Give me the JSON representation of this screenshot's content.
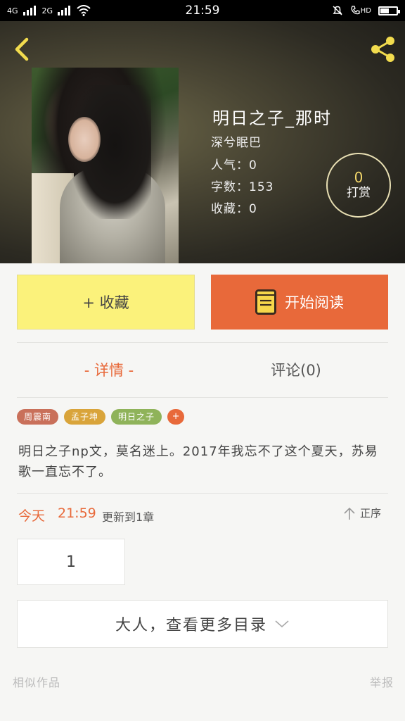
{
  "status_bar": {
    "network_1": "4G",
    "network_2": "2G",
    "time": "21:59",
    "hd": "HD"
  },
  "book": {
    "title": "明日之子_那时",
    "author": "深兮眠巴",
    "popularity": "人气：0",
    "word_count": "字数：153",
    "favorites": "收藏：0",
    "tip_count": "0",
    "tip_label": "打赏"
  },
  "actions": {
    "collect_label": "+ 收藏",
    "read_label": "开始阅读"
  },
  "tabs": {
    "detail": "-  详情  -",
    "comments": "评论(0)"
  },
  "tags": [
    {
      "label": "周震南",
      "color": "#c9705a"
    },
    {
      "label": "孟子坤",
      "color": "#d9a43a"
    },
    {
      "label": "明日之子",
      "color": "#8fb35a"
    }
  ],
  "tag_more": "+",
  "description": "明日之子np文，莫名迷上。2017年我忘不了这个夏天，苏易歌一直忘不了。",
  "update": {
    "today": "今天",
    "time": "21:59",
    "text": "更新到1章",
    "order_label": "正序"
  },
  "chapters": [
    "1"
  ],
  "more_catalog": "大人，查看更多目录",
  "footer": {
    "similar": "相似作品",
    "report": "举报"
  },
  "colors": {
    "accent": "#e8693a",
    "collect_bg": "#fbf27b",
    "tip": "#f3d76a"
  },
  "icons": {
    "back": "chevron-left-icon",
    "share": "share-icon",
    "book": "book-icon",
    "order": "arrow-up-icon",
    "expand": "chevron-down-icon"
  }
}
